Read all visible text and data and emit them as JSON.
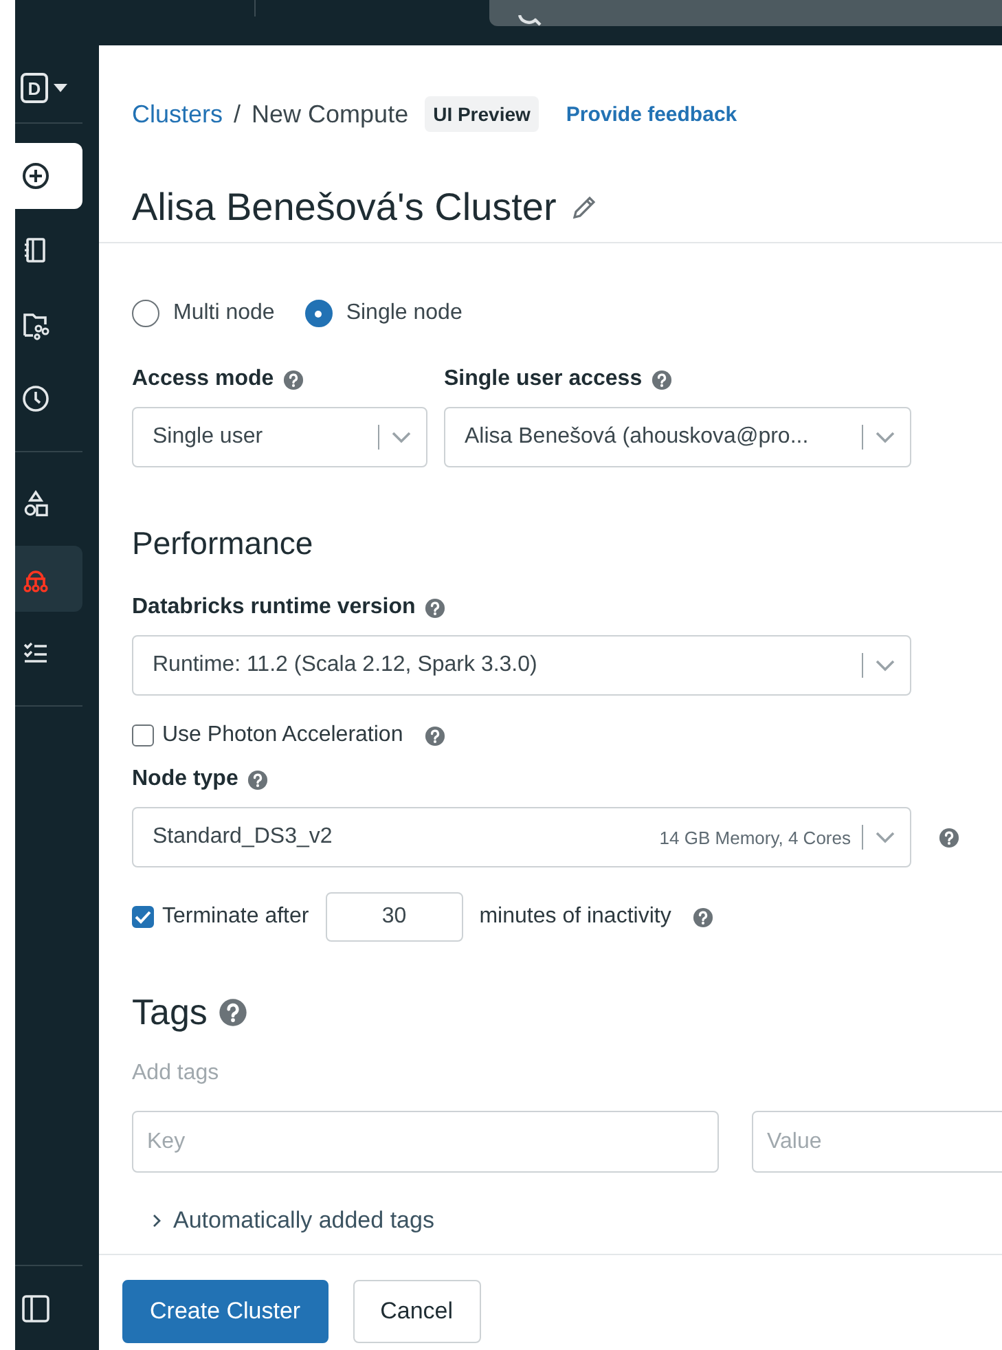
{
  "sidebar": {
    "workspace": "D",
    "groups": [
      [
        {
          "kind": "new",
          "selected": false
        },
        {
          "kind": "notebook",
          "selected": false
        },
        {
          "kind": "repo",
          "selected": false
        },
        {
          "kind": "history",
          "selected": false
        }
      ],
      [
        {
          "kind": "shapes",
          "selected": false
        },
        {
          "kind": "compute",
          "selected": true
        },
        {
          "kind": "tasks",
          "selected": false
        }
      ]
    ]
  },
  "breadcrumb": {
    "parent": "Clusters",
    "separator": "/",
    "current": "New Compute",
    "badge": "UI Preview",
    "feedback_link": "Provide feedback"
  },
  "title": "Alisa Benešová's Cluster",
  "node_mode": [
    {
      "label": "Multi node",
      "selected": false
    },
    {
      "label": "Single node",
      "selected": true
    }
  ],
  "access_mode": {
    "label": "Access mode",
    "value": "Single user"
  },
  "single_user_access": {
    "label": "Single user access",
    "value": "Alisa Benešová (ahouskova@pro..."
  },
  "performance": {
    "heading": "Performance",
    "runtime": {
      "label": "Databricks runtime version",
      "value": "Runtime: 11.2 (Scala 2.12, Spark 3.3.0)"
    },
    "photon": {
      "label": "Use Photon Acceleration",
      "checked": false
    },
    "node_type": {
      "label": "Node type",
      "value": "Standard_DS3_v2",
      "detail": "14 GB Memory, 4 Cores"
    },
    "terminate": {
      "checked": true,
      "label": "Terminate after",
      "minutes": "30",
      "suffix": "minutes of inactivity"
    }
  },
  "tags": {
    "heading": "Tags",
    "hint": "Add tags",
    "key_placeholder": "Key",
    "value_placeholder": "Value",
    "auto_tags": {
      "label": "Automatically added tags",
      "expanded": false
    }
  },
  "buttons": [
    {
      "label": "Create Cluster",
      "kind": "primary"
    },
    {
      "label": "Cancel",
      "kind": "secondary"
    }
  ]
}
